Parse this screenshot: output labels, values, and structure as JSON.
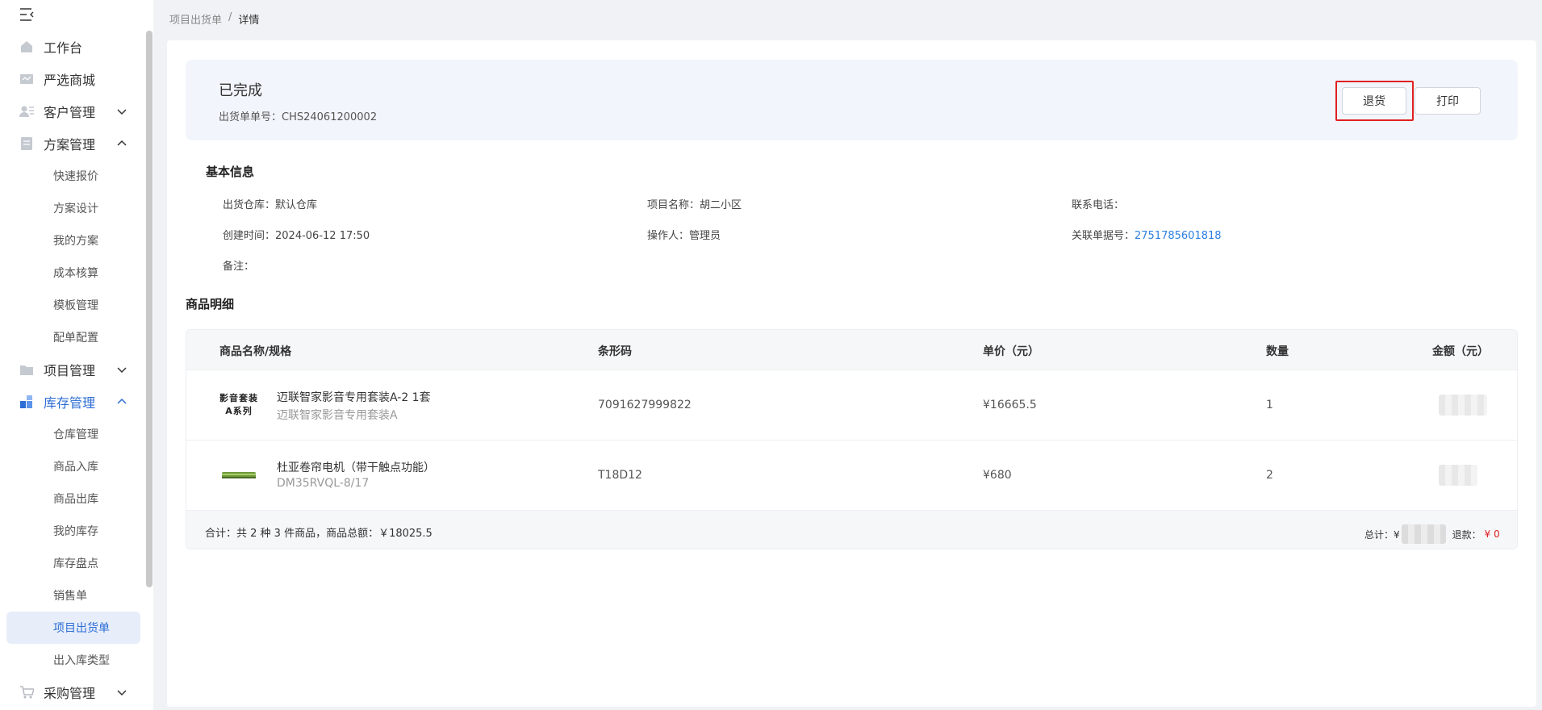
{
  "breadcrumb": {
    "parent": "项目出货单",
    "separator": "/",
    "current": "详情"
  },
  "sidebar": {
    "items": [
      {
        "label": "工作台",
        "icon": "home-icon"
      },
      {
        "label": "严选商城",
        "icon": "store-icon"
      },
      {
        "label": "客户管理",
        "icon": "customer-icon",
        "expanded": false
      },
      {
        "label": "方案管理",
        "icon": "document-icon",
        "expanded": true,
        "children": [
          "快速报价",
          "方案设计",
          "我的方案",
          "成本核算",
          "模板管理",
          "配单配置"
        ]
      },
      {
        "label": "项目管理",
        "icon": "folder-icon",
        "expanded": false
      },
      {
        "label": "库存管理",
        "icon": "inventory-icon",
        "expanded": true,
        "active": true,
        "children": [
          "仓库管理",
          "商品入库",
          "商品出库",
          "我的库存",
          "库存盘点",
          "销售单",
          "项目出货单",
          "出入库类型"
        ],
        "selected": "项目出货单"
      },
      {
        "label": "采购管理",
        "icon": "cart-icon",
        "expanded": false
      }
    ]
  },
  "status": {
    "title": "已完成",
    "order_label": "出货单单号：",
    "order_no": "CHS24061200002",
    "return_button": "退货",
    "print_button": "打印"
  },
  "basic_info": {
    "title": "基本信息",
    "fields": [
      {
        "label": "出货仓库：",
        "value": "默认仓库"
      },
      {
        "label": "项目名称：",
        "value": "胡二小区"
      },
      {
        "label": "联系电话：",
        "value": ""
      },
      {
        "label": "创建时间：",
        "value": "2024-06-12 17:50"
      },
      {
        "label": "操作人：",
        "value": "管理员"
      },
      {
        "label": "关联单据号：",
        "value": "2751785601818"
      },
      {
        "label": "备注：",
        "value": ""
      }
    ]
  },
  "products": {
    "title": "商品明细",
    "columns": [
      "商品名称/规格",
      "条形码",
      "单价（元）",
      "数量",
      "金额（元）"
    ],
    "rows": [
      {
        "thumb_line1": "影音套装",
        "thumb_line2": "A系列",
        "name": "迈联智家影音专用套装A-2 1套",
        "spec": "迈联智家影音专用套装A",
        "barcode": "7091627999822",
        "price": "¥16665.5",
        "qty": "1"
      },
      {
        "thumb_line1": "",
        "thumb_line2": "",
        "name": "杜亚卷帘电机（带干触点功能）",
        "spec": "DM35RVQL-8/17",
        "barcode": "T18D12",
        "price": "¥680",
        "qty": "2"
      }
    ],
    "footer_summary": "合计：共 2 种 3 件商品，商品总额：￥18025.5",
    "total_label": "总计：¥",
    "refund_label": "退款：",
    "refund_value": "¥ 0"
  },
  "colors": {
    "accent": "#2d6dd6",
    "highlight": "#e02020",
    "link": "#2d7fe0"
  }
}
